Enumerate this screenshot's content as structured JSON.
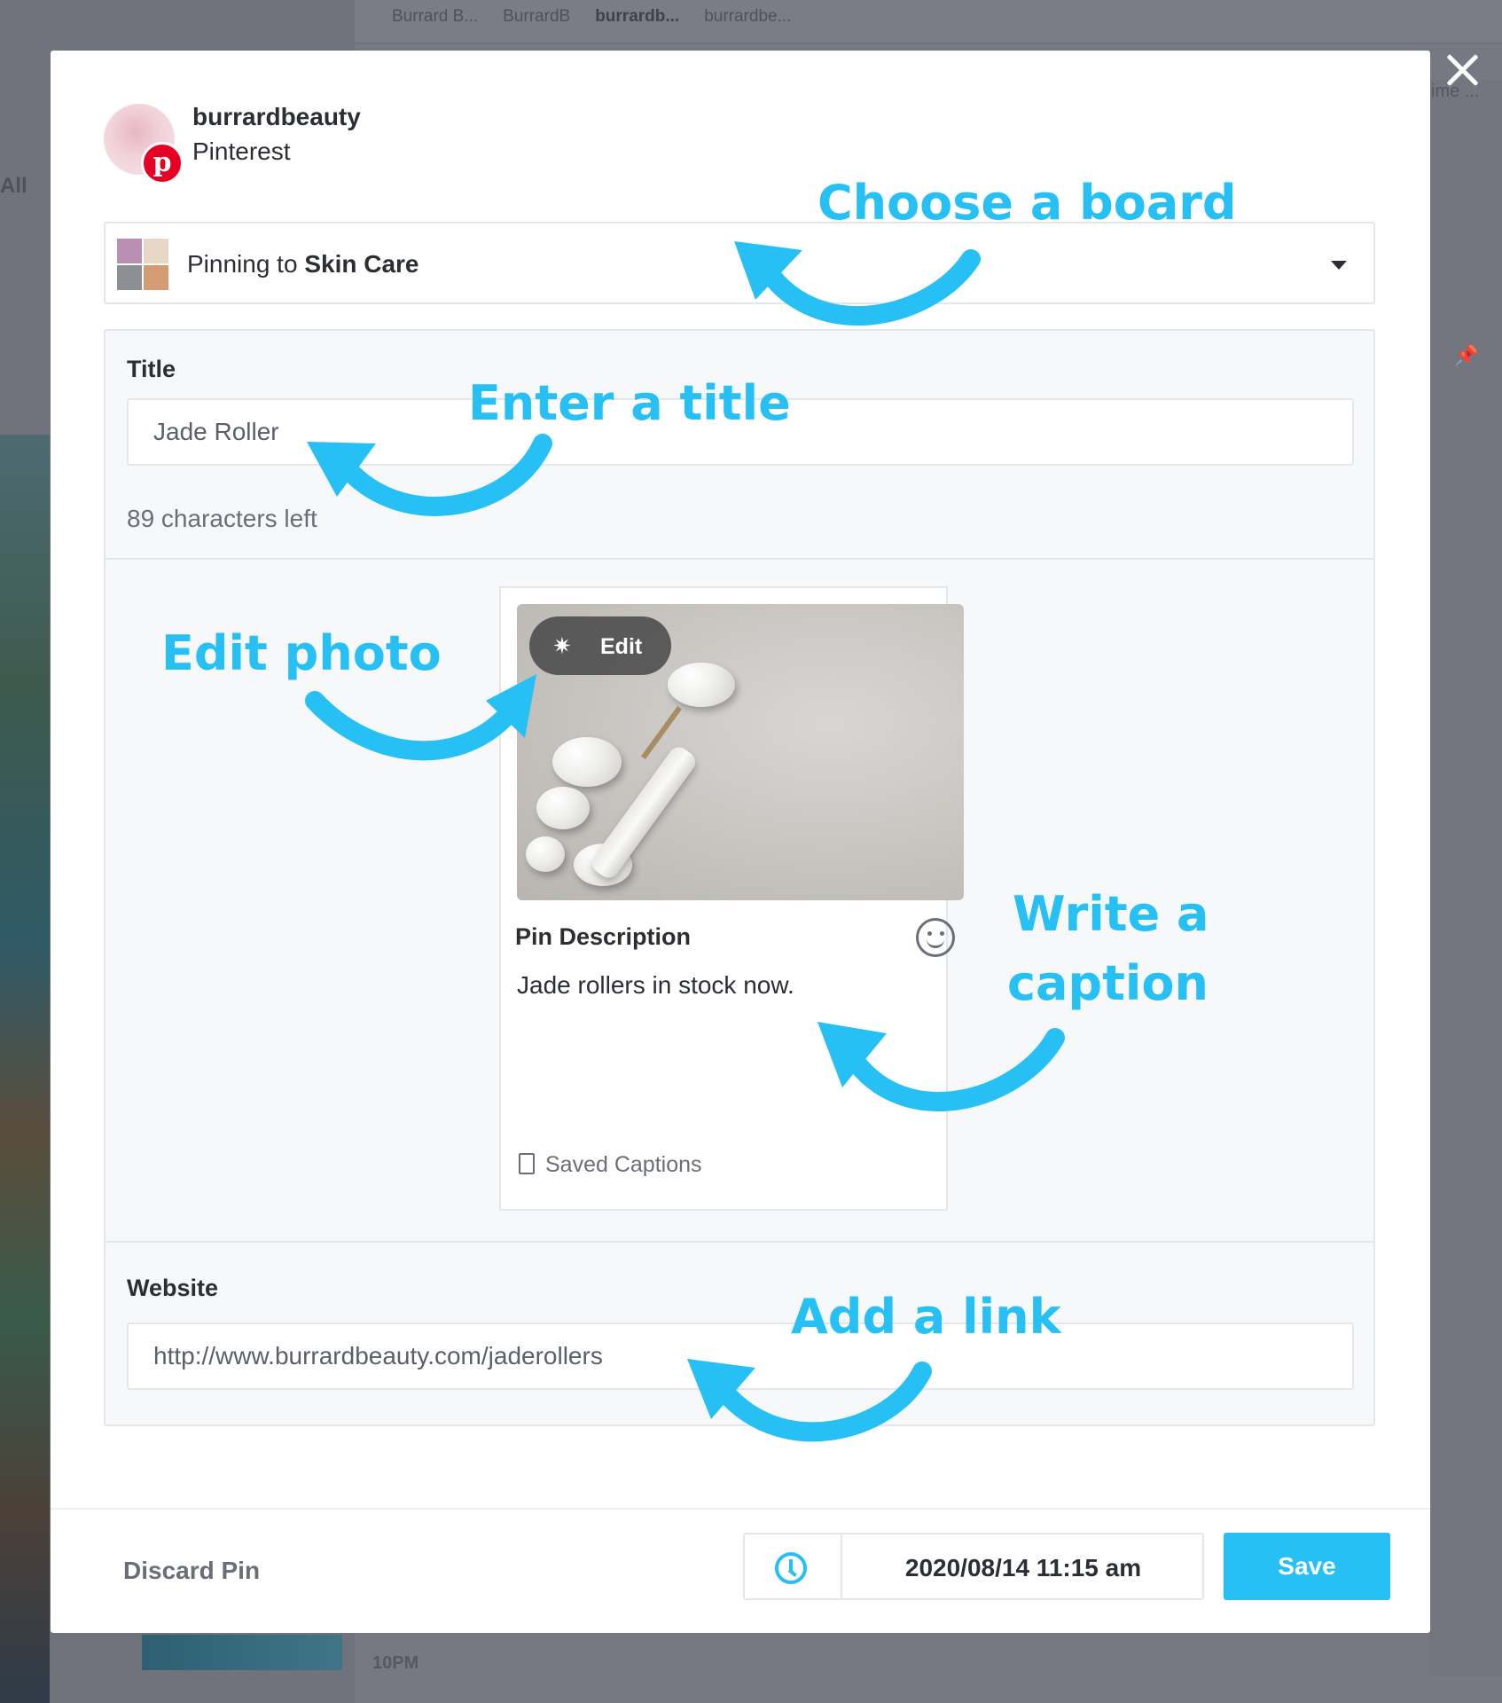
{
  "background": {
    "tabs": [
      "Burrard B...",
      "BurrardB",
      "burrardb...",
      "burrardbe..."
    ],
    "left_label": "All",
    "right_label": "ime ...",
    "bottom_time": "10PM"
  },
  "modal": {
    "account": {
      "name": "burrardbeauty",
      "network": "Pinterest",
      "badge_glyph": "p"
    },
    "board": {
      "prefix": "Pinning to",
      "name": "Skin Care"
    },
    "title_section": {
      "label": "Title",
      "value": "Jade Roller",
      "char_count": "89 characters left"
    },
    "pin": {
      "edit_label": "Edit",
      "description_label": "Pin Description",
      "description_text": "Jade rollers in stock now.",
      "saved_captions_label": "Saved Captions"
    },
    "website_section": {
      "label": "Website",
      "value": "http://www.burrardbeauty.com/jaderollers"
    },
    "footer": {
      "discard_label": "Discard Pin",
      "schedule_datetime": "2020/08/14 11:15 am",
      "save_label": "Save"
    }
  },
  "annotations": {
    "choose_board": "Choose a board",
    "enter_title": "Enter a title",
    "edit_photo": "Edit photo",
    "write_caption_line1": "Write a",
    "write_caption_line2": "caption",
    "add_link": "Add a link"
  },
  "colors": {
    "accent": "#27c0f5",
    "pinterest_red": "#e60023",
    "text_primary": "#2b2e33",
    "text_muted": "#6a6f77",
    "overlay": "#767982"
  }
}
